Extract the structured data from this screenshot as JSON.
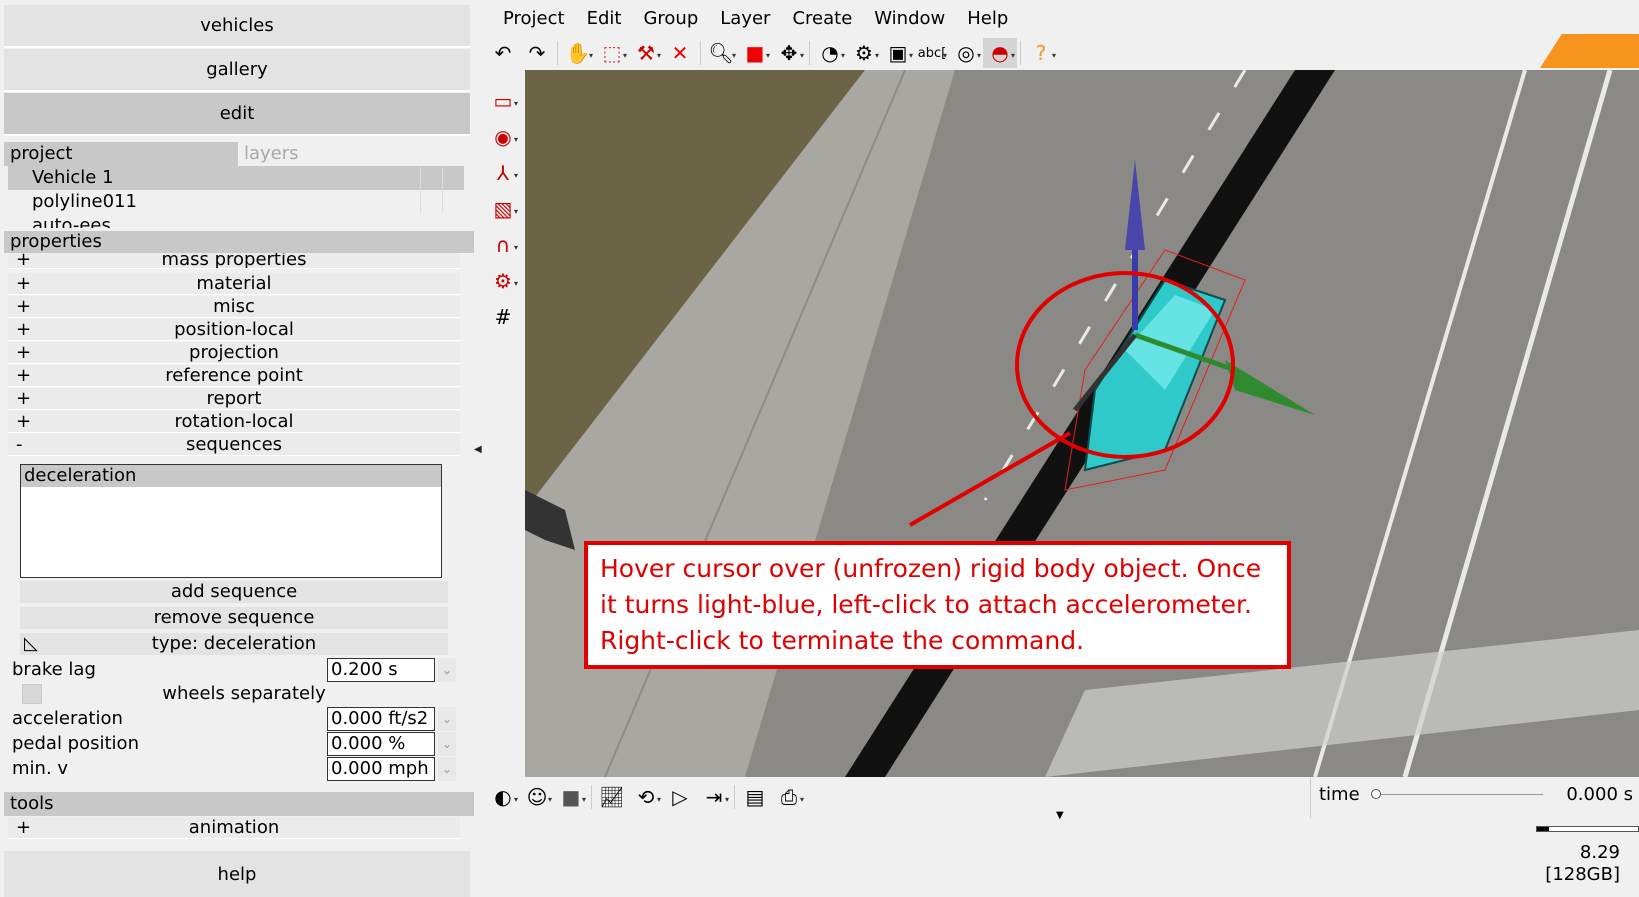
{
  "left_panel": {
    "nav": {
      "vehicles": "vehicles",
      "gallery": "gallery",
      "edit": "edit",
      "help": "help"
    },
    "tabs": {
      "project": "project",
      "layers": "layers"
    },
    "layers": [
      "Vehicle 1",
      "polyline011",
      "auto-ees"
    ],
    "properties_header": "properties",
    "properties": [
      {
        "sign": "+",
        "label": "mass properties"
      },
      {
        "sign": "+",
        "label": "material"
      },
      {
        "sign": "+",
        "label": "misc"
      },
      {
        "sign": "+",
        "label": "position-local"
      },
      {
        "sign": "+",
        "label": "projection"
      },
      {
        "sign": "+",
        "label": "reference point"
      },
      {
        "sign": "+",
        "label": "report"
      },
      {
        "sign": "+",
        "label": "rotation-local"
      },
      {
        "sign": "-",
        "label": "sequences"
      }
    ],
    "sequences": {
      "items": [
        "deceleration"
      ],
      "add": "add sequence",
      "remove": "remove sequence",
      "type": "type: deceleration"
    },
    "fields": {
      "brake_lag": {
        "label": "brake lag",
        "value": "0.200 s"
      },
      "wheels_separately": {
        "label": "wheels separately"
      },
      "acceleration": {
        "label": "acceleration",
        "value": "0.000 ft/s2"
      },
      "pedal_position": {
        "label": "pedal position",
        "value": "0.000 %"
      },
      "min_v": {
        "label": "min. v",
        "value": "0.000 mph"
      }
    },
    "tools_header": "tools",
    "tools": [
      {
        "sign": "+",
        "label": "animation"
      }
    ]
  },
  "menu": [
    "Project",
    "Edit",
    "Group",
    "Layer",
    "Create",
    "Window",
    "Help"
  ],
  "toolbar_icons": [
    "undo-icon",
    "redo-icon",
    "hand-icon",
    "select-icon",
    "snap-icon",
    "delete-icon",
    "zoom-icon",
    "cube-icon",
    "move-icon",
    "measure-icon",
    "group-icon",
    "display-icon",
    "text-icon",
    "target-icon",
    "gauge-icon",
    "help-icon"
  ],
  "toolbar_text": {
    "abc": "abc"
  },
  "callout": {
    "line1": "Hover cursor over (unfrozen) rigid body object. Once",
    "line2": "it turns light-blue, left-click to attach accelerometer.",
    "line3": "Right-click to terminate the command."
  },
  "status": {
    "time_label": "time",
    "time_value": "0.000 s",
    "progress": 0.12,
    "mem_value": "8.29",
    "mem_size": "[128GB]"
  },
  "colors": {
    "accent": "#f7941d",
    "callout": "#e00000",
    "car": "#2fc9c9"
  }
}
